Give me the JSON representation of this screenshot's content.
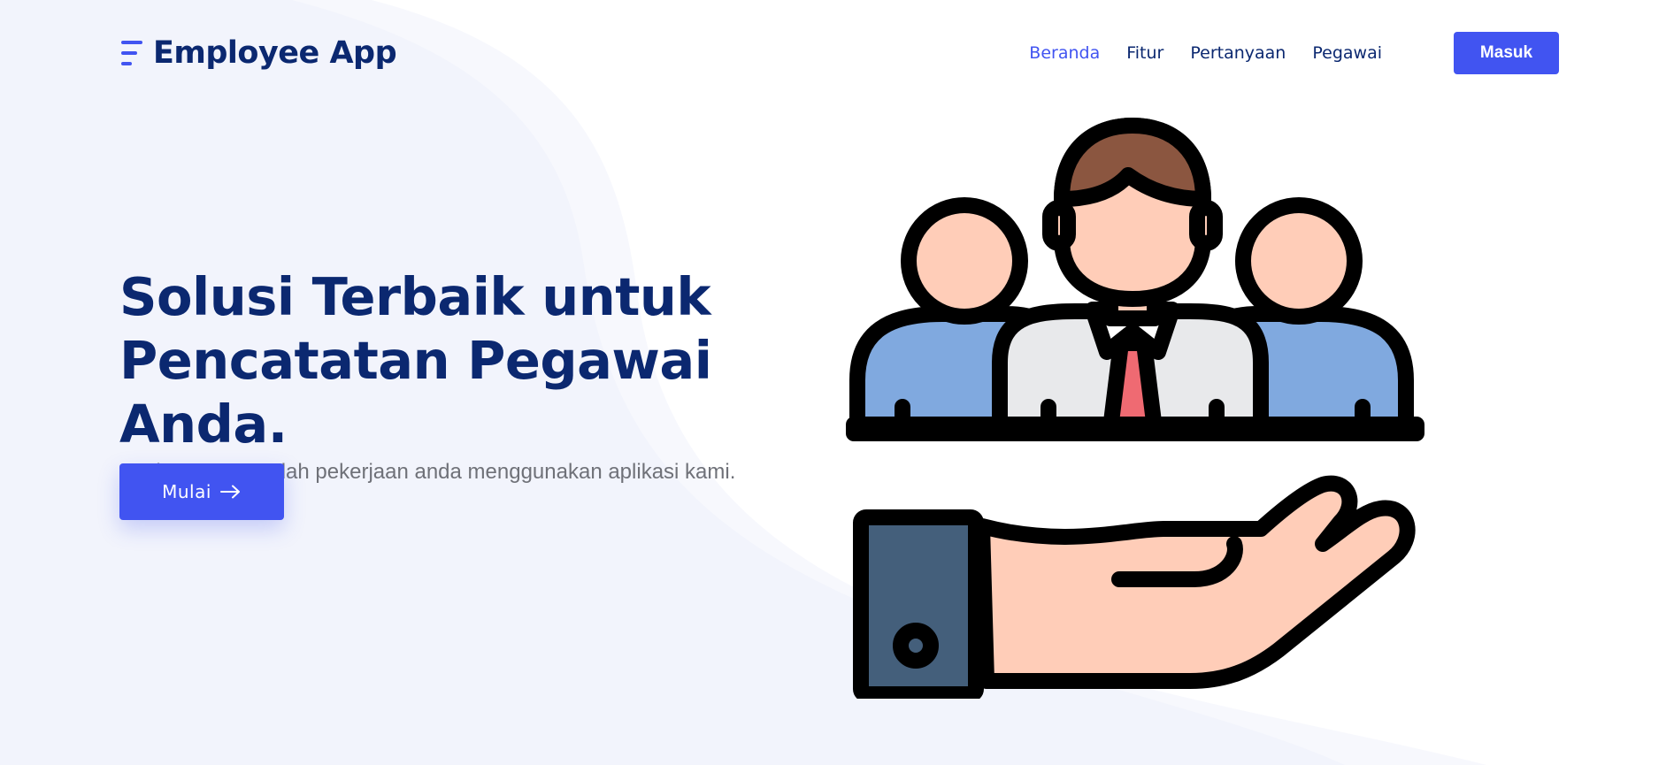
{
  "header": {
    "app_name": "Employee App",
    "logo_icon": "hamburger-bars-icon",
    "nav": [
      {
        "label": "Beranda",
        "active": true
      },
      {
        "label": "Fitur",
        "active": false
      },
      {
        "label": "Pertanyaan",
        "active": false
      },
      {
        "label": "Pegawai",
        "active": false
      }
    ],
    "login_label": "Masuk"
  },
  "hero": {
    "title_line1": "Solusi Terbaik untuk",
    "title_line2": "Pencatatan Pegawai Anda.",
    "subtitle": "Mari mempermudah pekerjaan anda menggunakan aplikasi kami.",
    "cta_label": "Mulai",
    "cta_icon": "arrow-right-icon",
    "illustration": "team-in-hand-illustration"
  },
  "colors": {
    "primary": "#4154f1",
    "heading": "#0b2870",
    "muted_text": "#6f7178",
    "background_tint": "#f2f4fc",
    "nav_active": "#4154f1"
  }
}
